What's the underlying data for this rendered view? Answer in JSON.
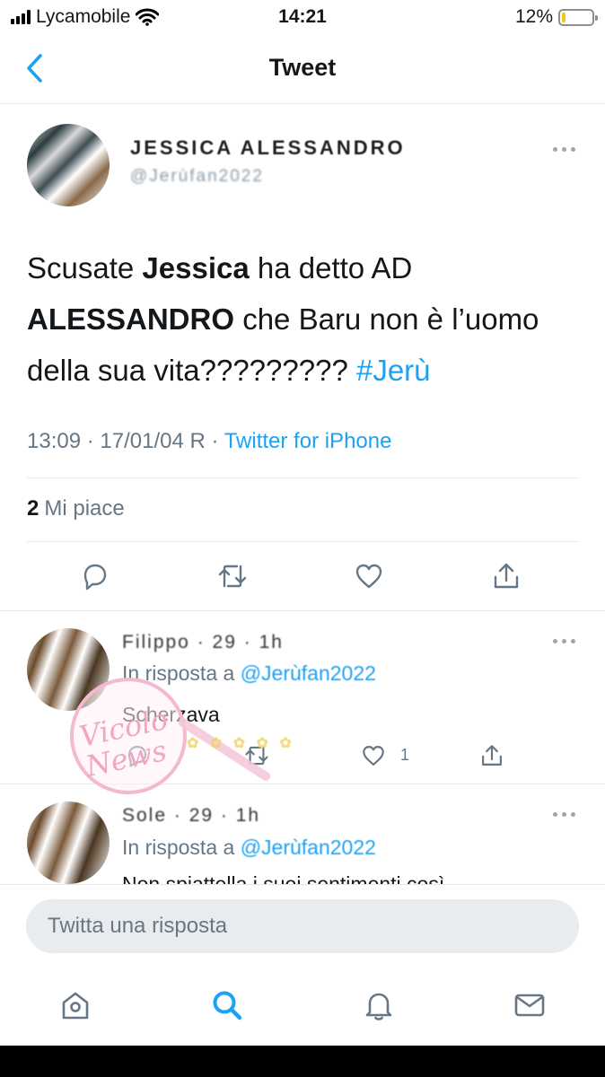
{
  "status_bar": {
    "carrier": "Lycamobile",
    "time": "14:21",
    "battery_percent": "12%",
    "battery_level": 0.12
  },
  "nav": {
    "title": "Tweet"
  },
  "tweet": {
    "author_name": "JESSICA ALESSANDRO",
    "author_handle": "@Jerùfan2022",
    "text": {
      "part1": "Scusate ",
      "bold1": "Jessica",
      "part2": " ha detto AD ",
      "bold2": "ALESSANDRO",
      "part3": " che Baru non è l’uomo della sua vita????????? ",
      "hashtag": "#Jerù"
    },
    "timestamp": "13:09 · 17/01/04 R · ",
    "source": "Twitter for iPhone",
    "likes_count": "2",
    "likes_label": "Mi piace"
  },
  "replies": [
    {
      "name": "Filippo",
      "time": "29 · 1h",
      "reply_to_label": "In risposta a ",
      "reply_to_handle": "@Jerùfan2022",
      "text": "Scherzava",
      "like_count": "1"
    },
    {
      "name": "Sole",
      "time": "29 · 1h",
      "reply_to_label": "In risposta a ",
      "reply_to_handle": "@Jerùfan2022",
      "text": "Non spiattella i suoi sentimenti così"
    }
  ],
  "watermark": {
    "text": "Vicolo delle News"
  },
  "reply_bar": {
    "placeholder": "Twitta una risposta"
  },
  "icons": {
    "back": "chevron-left-icon",
    "more": "more-icon",
    "reply": "reply-icon",
    "retweet": "retweet-icon",
    "like": "heart-icon",
    "share": "share-icon",
    "home": "home-icon",
    "search": "search-icon",
    "notifications": "bell-icon",
    "messages": "mail-icon"
  },
  "colors": {
    "accent": "#1da1f2",
    "secondary_text": "#657786",
    "divider": "#e1e8ed",
    "battery": "#f5c518"
  }
}
